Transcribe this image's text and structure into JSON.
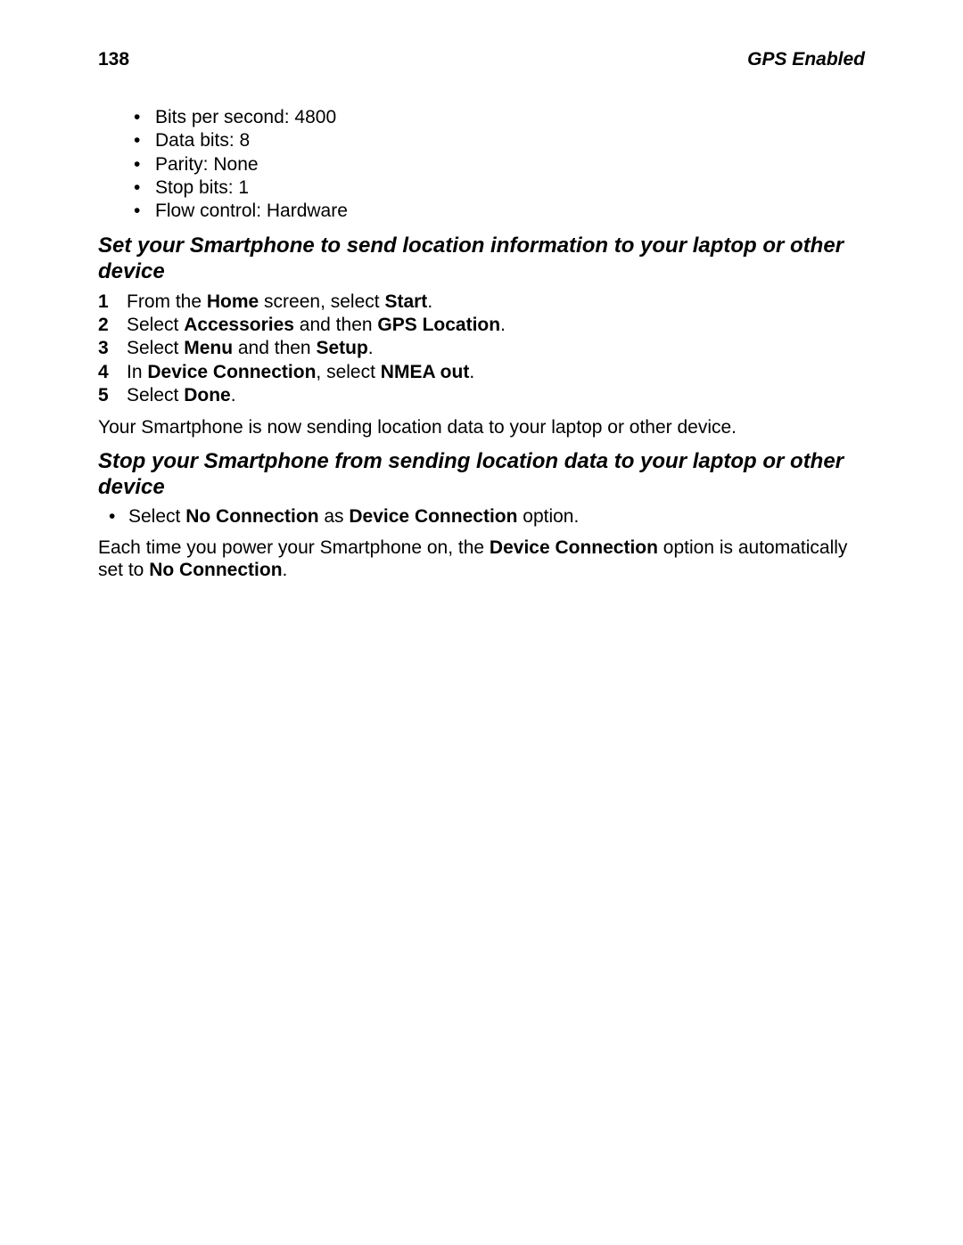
{
  "header": {
    "page_number": "138",
    "title": "GPS Enabled"
  },
  "serial_settings": {
    "items": [
      "Bits per second: 4800",
      "Data bits: 8",
      "Parity: None",
      "Stop bits: 1",
      "Flow control: Hardware"
    ]
  },
  "section1": {
    "heading": "Set your Smartphone to send location information to your laptop or other device",
    "steps": [
      {
        "n": "1",
        "pre": "From the ",
        "b1": "Home",
        "mid": " screen, select ",
        "b2": "Start",
        "post": "."
      },
      {
        "n": "2",
        "pre": "Select ",
        "b1": "Accessories",
        "mid": " and then ",
        "b2": "GPS Location",
        "post": "."
      },
      {
        "n": "3",
        "pre": "Select ",
        "b1": "Menu",
        "mid": " and then ",
        "b2": "Setup",
        "post": "."
      },
      {
        "n": "4",
        "pre": "In ",
        "b1": "Device Connection",
        "mid": ", select ",
        "b2": "NMEA out",
        "post": "."
      },
      {
        "n": "5",
        "pre": "Select ",
        "b1": "Done",
        "mid": "",
        "b2": "",
        "post": "."
      }
    ],
    "after": "Your Smartphone is now sending location data to your laptop or other device."
  },
  "section2": {
    "heading": "Stop your Smartphone from sending location data to your laptop or other device",
    "bullet": {
      "pre": "Select ",
      "b1": "No Connection",
      "mid": " as ",
      "b2": "Device Connection",
      "post": " option."
    },
    "after": {
      "pre": "Each time you power your Smartphone on, the ",
      "b1": "Device Connection",
      "mid": " option is automatically set to ",
      "b2": "No Connection",
      "post": "."
    }
  }
}
